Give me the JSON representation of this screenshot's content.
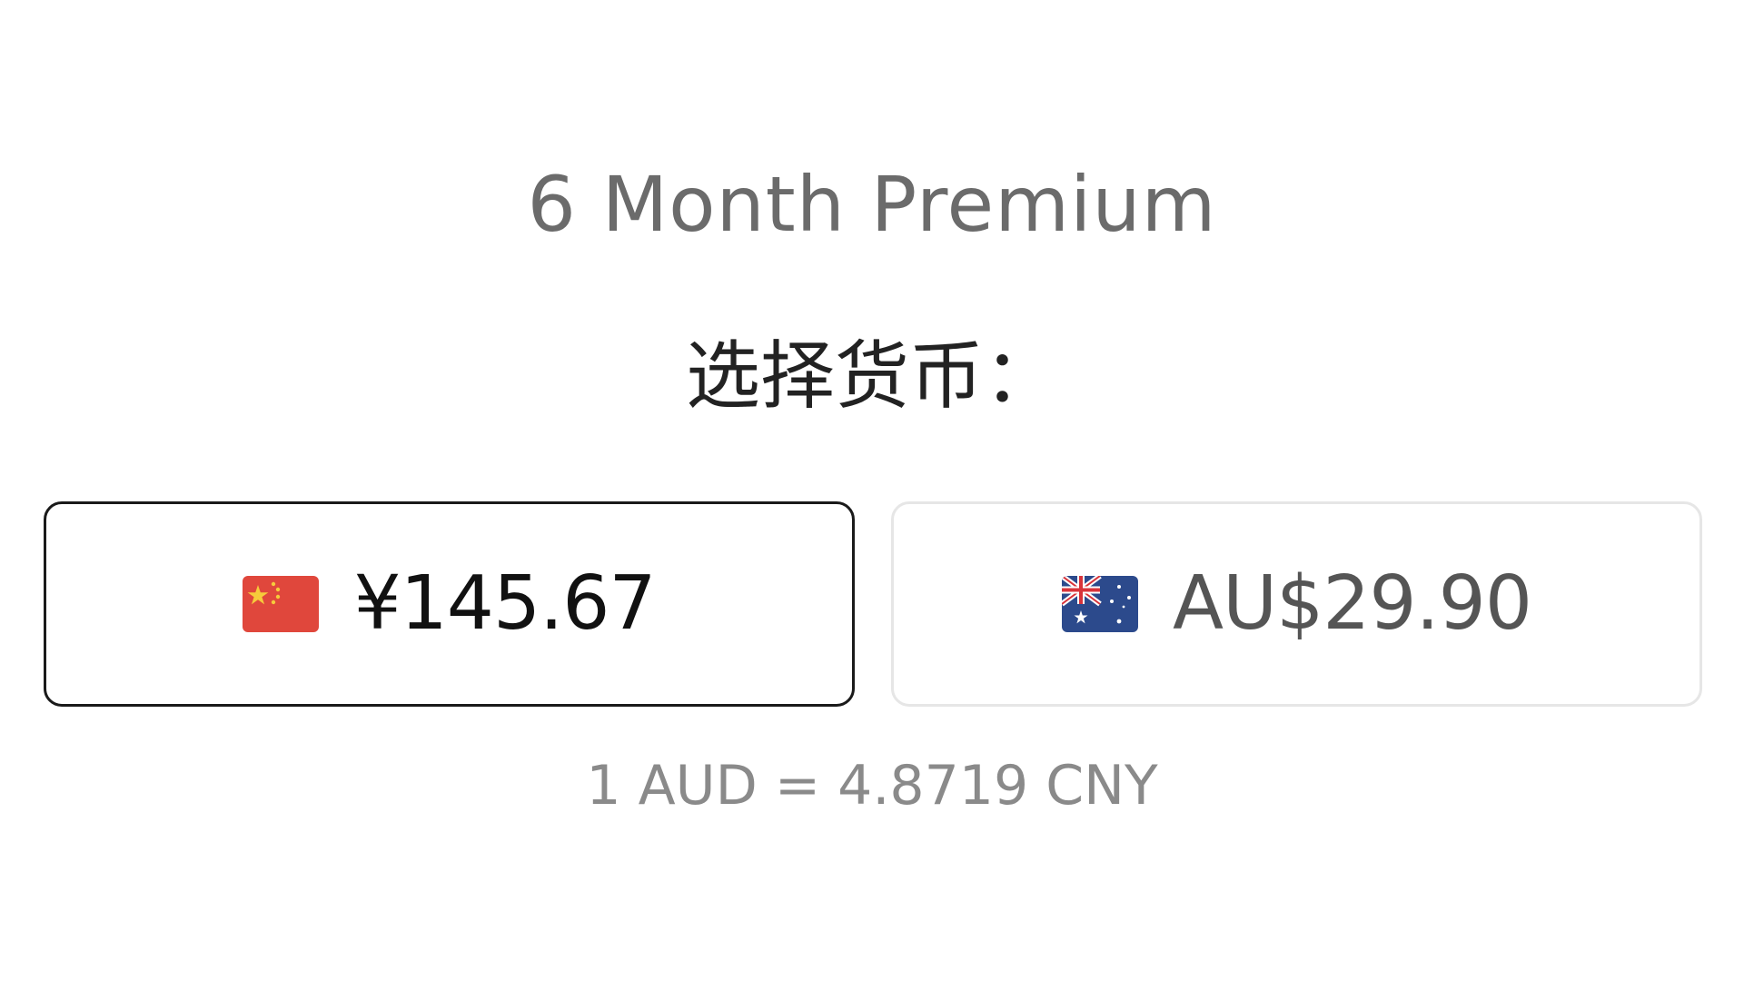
{
  "plan": {
    "title": "6 Month Premium"
  },
  "currency_prompt": "选择货币：",
  "options": [
    {
      "flag_icon": "china-flag-icon",
      "price": "¥145.67",
      "selected": true
    },
    {
      "flag_icon": "australia-flag-icon",
      "price": "AU$29.90",
      "selected": false
    }
  ],
  "exchange_rate": "1 AUD = 4.8719 CNY",
  "colors": {
    "selected_border": "#1a1a1a",
    "unselected_border": "#e6e6e6",
    "china_flag_red": "#e0473c",
    "china_flag_yellow": "#f6cb3b",
    "australia_flag_blue": "#2c4a8c"
  }
}
